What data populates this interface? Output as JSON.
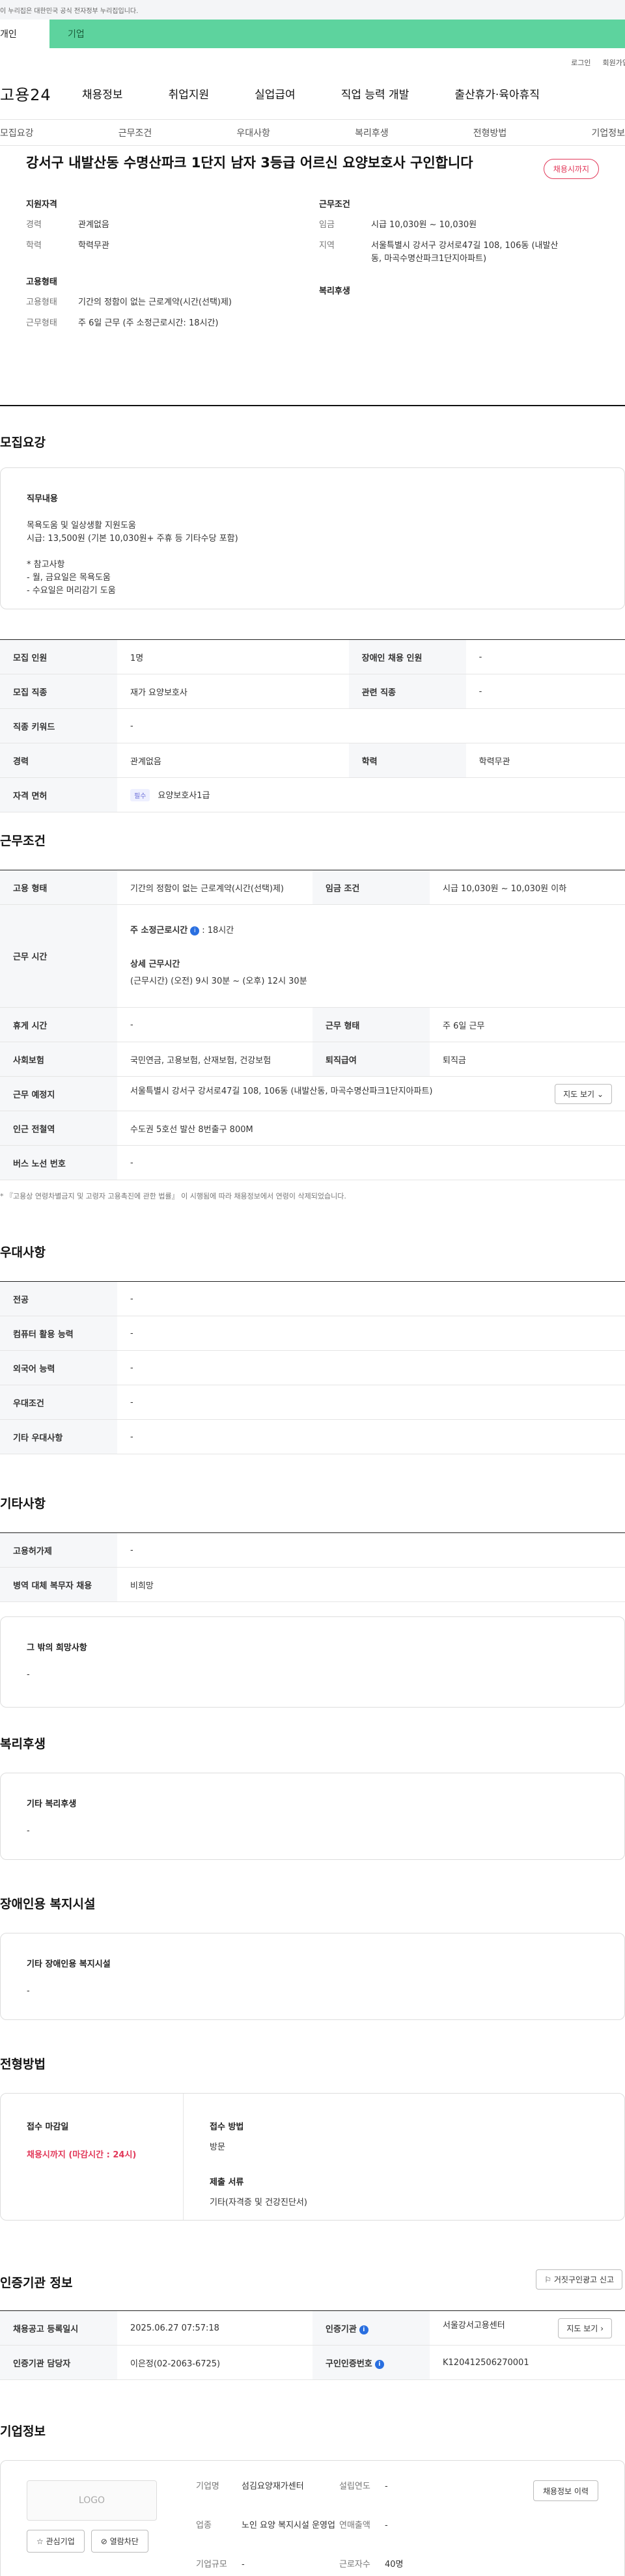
{
  "gov_banner": "이 누리집은 대한민국 공식 전자정부 누리집입니다.",
  "tabs": {
    "person": "개인",
    "company": "기업"
  },
  "utils": {
    "login": "로그인",
    "join": "회원가입"
  },
  "gnb": {
    "logo": "고용24",
    "menus": [
      "채용정보",
      "취업지원",
      "실업급여",
      "직업 능력 개발",
      "출산휴가·육아휴직"
    ]
  },
  "anchor": [
    "모집요강",
    "근무조건",
    "우대사항",
    "복리후생",
    "전형방법",
    "기업정보"
  ],
  "summary": {
    "title": "강서구 내발산동 수명산파크 1단지 남자 3등급 어르신 요양보호사 구인합니다",
    "status": "채용시까지",
    "qual_title": "지원자격",
    "exp_k": "경력",
    "exp_v": "관계없음",
    "edu_k": "학력",
    "edu_v": "학력무관",
    "cond_title": "근무조건",
    "wage_k": "임금",
    "wage_v": "시급 10,030원 ~ 10,030원",
    "region_k": "지역",
    "region_v": "서울특별시 강서구 강서로47길 108, 106동 (내발산동, 마곡수명산파크1단지아파트)",
    "emp_title": "고용형태",
    "type_k": "고용형태",
    "type_v": "기간의 정함이 없는 근로계약(시간(선택)제)",
    "wtype_k": "근무형태",
    "wtype_v": "주 6일 근무 (주 소정근로시간: 18시간)",
    "welfare_title": "복리후생"
  },
  "recruit": {
    "title": "모집요강",
    "duty_title": "직무내용",
    "duty_body": "목욕도움 및 일상생활 지원도움\n시급: 13,500원 (기본 10,030원+ 주휴 등 기타수당 포함)\n\n* 참고사항\n- 월, 금요일은 목욕도움\n- 수요일은 머리감기 도움",
    "rows": [
      [
        "모집 인원",
        "1명",
        "장애인 채용 인원",
        "-"
      ],
      [
        "모집 직종",
        "재가 요양보호사",
        "관련 직종",
        "-"
      ],
      [
        "직종 키워드",
        "-"
      ],
      [
        "경력",
        "관계없음",
        "학력",
        "학력무관"
      ],
      [
        "자격 면허",
        "필수",
        "요양보호사1급"
      ]
    ]
  },
  "work": {
    "title": "근무조건",
    "type_k": "고용 형태",
    "type_v": "기간의 정함이 없는 근로계약(시간(선택)제)",
    "wage_k": "임금 조건",
    "wage_v": "시급 10,030원 ~ 10,030원 이하",
    "hours_k": "근무 시간",
    "hours_1": "주 소정근로시간",
    "hours_1v": ": 18시간",
    "hours_2": "상세 근무시간",
    "hours_3": "(근무시간) (오전) 9시 30분 ~ (오후) 12시 30분",
    "rest_k": "휴게 시간",
    "rest_v": "-",
    "form_k": "근무 형태",
    "form_v": "주 6일 근무",
    "ins_k": "사회보험",
    "ins_v": "국민연금, 고용보험, 산재보험, 건강보험",
    "ret_k": "퇴직급여",
    "ret_v": "퇴직금",
    "place_k": "근무 예정지",
    "place_v": "서울특별시 강서구 강서로47길 108, 106동 (내발산동, 마곡수명산파크1단지아파트)",
    "map_btn": "지도 보기",
    "sub_k": "인근 전철역",
    "sub_v": "수도권 5호선 발산 8번출구 800M",
    "bus_k": "버스 노선 번호",
    "bus_v": "-",
    "note": "* 『고용상 연령차별금지 및 고령자 고용촉진에 관한 법률』 이 시행됨에 따라 채용정보에서 연령이 삭제되었습니다."
  },
  "pref": {
    "title": "우대사항",
    "rows": [
      [
        "전공",
        "-"
      ],
      [
        "컴퓨터 활용 능력",
        "-"
      ],
      [
        "외국어 능력",
        "-"
      ],
      [
        "우대조건",
        "-"
      ],
      [
        "기타 우대사항",
        "-"
      ]
    ]
  },
  "etc": {
    "title": "기타사항",
    "rows": [
      [
        "고용허가제",
        "-"
      ],
      [
        "병역 대체 복무자 채용",
        "비희망"
      ]
    ],
    "hope_title": "그 밖의 희망사항",
    "hope_v": "-"
  },
  "welfare": {
    "title": "복리후생",
    "box_title": "기타 복리후생",
    "box_v": "-"
  },
  "disabled": {
    "title": "장애인용 복지시설",
    "box_title": "기타 장애인용 복지시설",
    "box_v": "-"
  },
  "select": {
    "title": "전형방법",
    "deadline_k": "접수 마감일",
    "deadline_v": "채용시까지 (마감시간 : 24시)",
    "method_k": "접수 방법",
    "method_v": "방문",
    "doc_k": "제출 서류",
    "doc_v": "기타(자격증 및 건강진단서)"
  },
  "cert": {
    "title": "인증기관 정보",
    "report_btn": "거짓구인광고 신고",
    "reg_k": "채용공고 등록일시",
    "reg_v": "2025.06.27 07:57:18",
    "org_k": "인증기관",
    "org_v": "서울강서고용센터",
    "map_btn": "지도 보기",
    "mgr_k": "인증기관 담당자",
    "mgr_v": "이은정(02-2063-6725)",
    "num_k": "구인인증번호",
    "num_v": "K120412506270001"
  },
  "corp": {
    "title": "기업정보",
    "logo": "LOGO",
    "fav": "관심기업",
    "block": "열람차단",
    "name_k": "기업명",
    "name_v": "섬김요양재가센터",
    "found_k": "설립연도",
    "found_v": "-",
    "ind_k": "업종",
    "ind_v": "노인 요양 복지시설 운영업",
    "sales_k": "연매출액",
    "sales_v": "-",
    "staff_k": "근로자수",
    "staff_v": "40명",
    "size_k": "기업규모",
    "size_v": "-",
    "hist_btn": "채용정보 이력"
  }
}
